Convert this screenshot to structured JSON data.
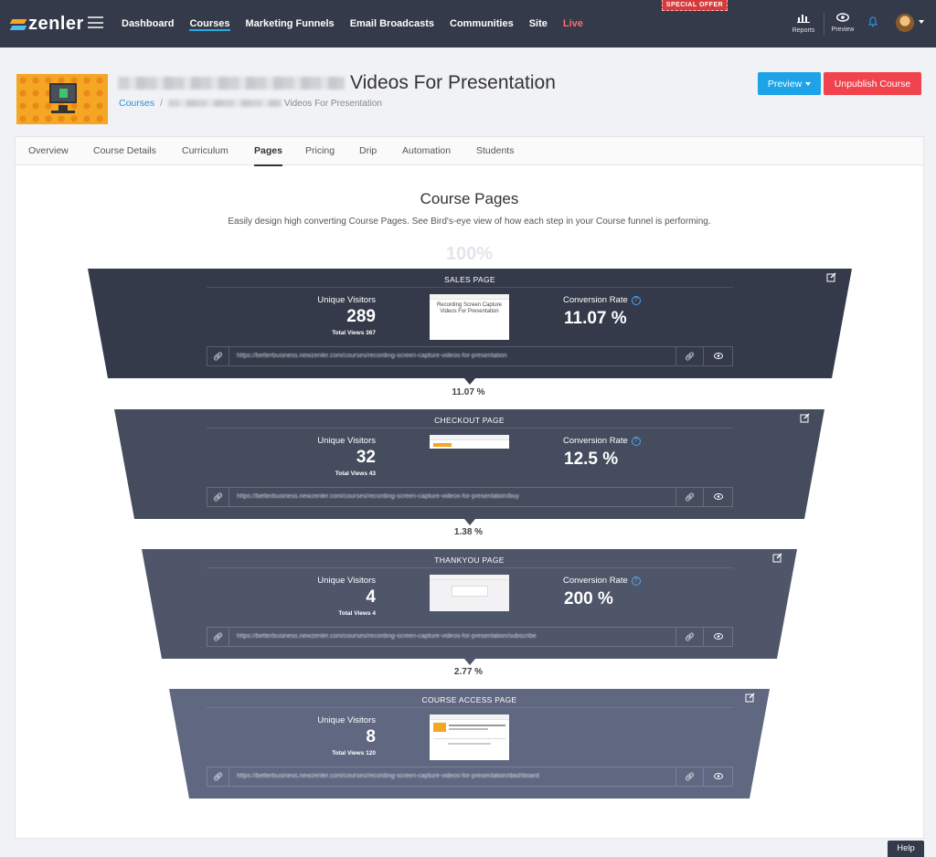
{
  "app": {
    "logo_text": "zenler"
  },
  "nav": {
    "items": [
      {
        "label": "Dashboard"
      },
      {
        "label": "Courses"
      },
      {
        "label": "Marketing Funnels"
      },
      {
        "label": "Email Broadcasts"
      },
      {
        "label": "Communities"
      },
      {
        "label": "Site"
      },
      {
        "label": "Live"
      }
    ],
    "special_offer": "SPECIAL OFFER",
    "reports_label": "Reports",
    "preview_label": "Preview"
  },
  "header": {
    "title_suffix": "Videos For Presentation",
    "breadcrumb_root": "Courses",
    "breadcrumb_sep": "/",
    "breadcrumb_current": "Videos For Presentation",
    "preview_button": "Preview",
    "unpublish_button": "Unpublish Course"
  },
  "tabs": [
    {
      "label": "Overview"
    },
    {
      "label": "Course Details"
    },
    {
      "label": "Curriculum"
    },
    {
      "label": "Pages"
    },
    {
      "label": "Pricing"
    },
    {
      "label": "Drip"
    },
    {
      "label": "Automation"
    },
    {
      "label": "Students"
    }
  ],
  "section": {
    "title": "Course Pages",
    "subtitle": "Easily design high converting Course Pages. See Bird's-eye view of how each step in your Course funnel is performing.",
    "top_percent": "100%"
  },
  "stages": [
    {
      "title": "SALES PAGE",
      "uv_label": "Unique Visitors",
      "uv": "289",
      "total_views": "Total Views 367",
      "cr_label": "Conversion Rate",
      "cr": "11.07 %",
      "preview_text": "Recording Screen Capture Videos For Presentation",
      "url": "https://betterbusiness.newzenler.com/courses/recording-screen-capture-videos-for-presentation",
      "color": "#343a4a"
    },
    {
      "title": "CHECKOUT PAGE",
      "uv_label": "Unique Visitors",
      "uv": "32",
      "total_views": "Total Views 43",
      "cr_label": "Conversion Rate",
      "cr": "12.5 %",
      "url": "https://betterbusiness.newzenler.com/courses/recording-screen-capture-videos-for-presentation/buy",
      "color": "#454c5e"
    },
    {
      "title": "THANKYOU PAGE",
      "uv_label": "Unique Visitors",
      "uv": "4",
      "total_views": "Total Views 4",
      "cr_label": "Conversion Rate",
      "cr": "200 %",
      "url": "https://betterbusiness.newzenler.com/courses/recording-screen-capture-videos-for-presentation/subscribe",
      "color": "#4f566a"
    },
    {
      "title": "COURSE ACCESS PAGE",
      "uv_label": "Unique Visitors",
      "uv": "8",
      "total_views": "Total Views 120",
      "url": "https://betterbusiness.newzenler.com/courses/recording-screen-capture-videos-for-presentation/dashboard",
      "color": "#5f6781"
    }
  ],
  "connectors": [
    "11.07 %",
    "1.38 %",
    "2.77 %"
  ],
  "help": "Help"
}
